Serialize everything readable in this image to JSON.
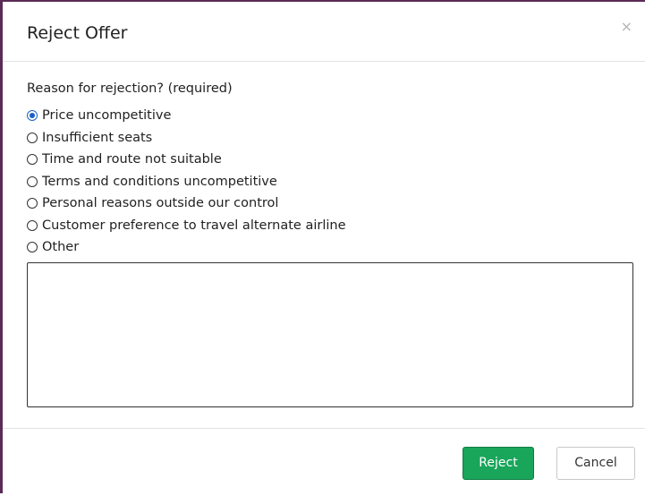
{
  "dialog": {
    "title": "Reject Offer",
    "close_label": "×"
  },
  "form": {
    "question": "Reason for rejection? (required)",
    "options": [
      {
        "label": "Price uncompetitive",
        "selected": true
      },
      {
        "label": "Insufficient seats",
        "selected": false
      },
      {
        "label": "Time and route not suitable",
        "selected": false
      },
      {
        "label": "Terms and conditions uncompetitive",
        "selected": false
      },
      {
        "label": "Personal reasons outside our control",
        "selected": false
      },
      {
        "label": "Customer preference to travel alternate airline",
        "selected": false
      },
      {
        "label": "Other",
        "selected": false
      }
    ],
    "other_text_value": ""
  },
  "footer": {
    "reject_label": "Reject",
    "cancel_label": "Cancel"
  },
  "colors": {
    "accent_border": "#5b2a55",
    "reject_button": "#19a55a",
    "radio_selected": "#1a5fc4"
  }
}
